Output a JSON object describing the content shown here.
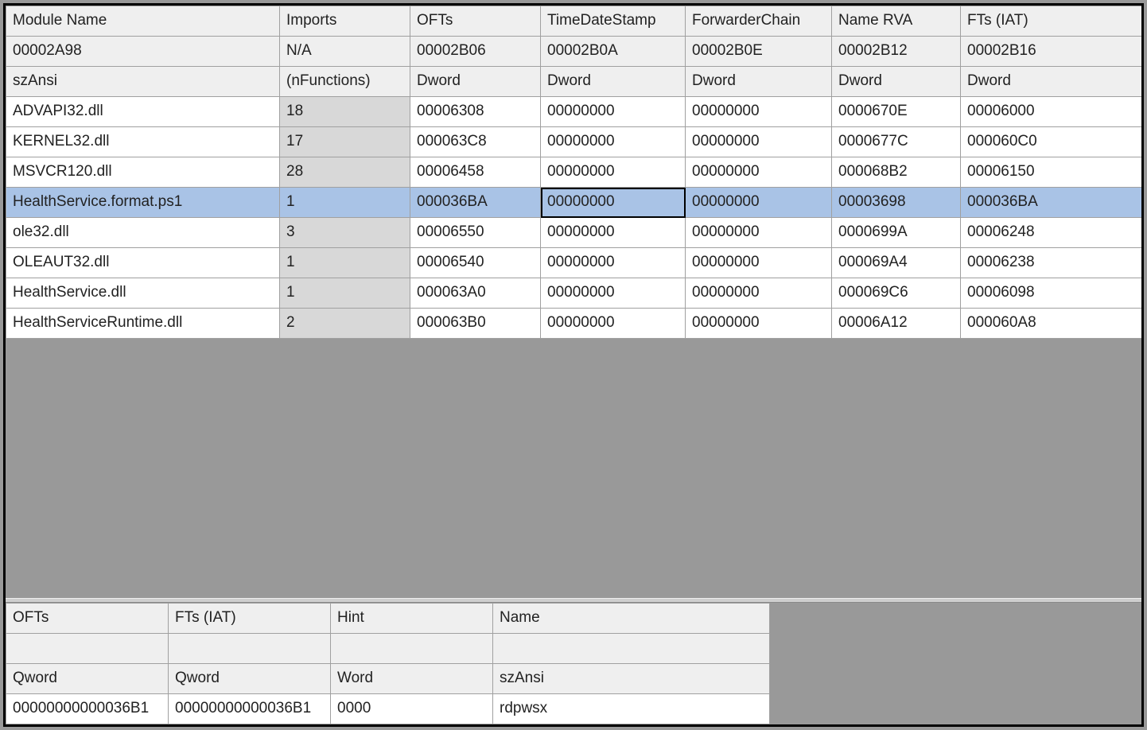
{
  "topTable": {
    "headerRow1": [
      "Module Name",
      "Imports",
      "OFTs",
      "TimeDateStamp",
      "ForwarderChain",
      "Name RVA",
      "FTs (IAT)"
    ],
    "headerRow2": [
      "00002A98",
      "N/A",
      "00002B06",
      "00002B0A",
      "00002B0E",
      "00002B12",
      "00002B16"
    ],
    "headerRow3": [
      "szAnsi",
      "(nFunctions)",
      "Dword",
      "Dword",
      "Dword",
      "Dword",
      "Dword"
    ],
    "rows": [
      {
        "module": "ADVAPI32.dll",
        "imports": "18",
        "ofts": "00006308",
        "tds": "00000000",
        "fc": "00000000",
        "rva": "0000670E",
        "fts": "00006000"
      },
      {
        "module": "KERNEL32.dll",
        "imports": "17",
        "ofts": "000063C8",
        "tds": "00000000",
        "fc": "00000000",
        "rva": "0000677C",
        "fts": "000060C0"
      },
      {
        "module": "MSVCR120.dll",
        "imports": "28",
        "ofts": "00006458",
        "tds": "00000000",
        "fc": "00000000",
        "rva": "000068B2",
        "fts": "00006150"
      },
      {
        "module": "HealthService.format.ps1",
        "imports": "1",
        "ofts": "000036BA",
        "tds": "00000000",
        "fc": "00000000",
        "rva": "00003698",
        "fts": "000036BA",
        "selected": true,
        "focusCol": 3
      },
      {
        "module": "ole32.dll",
        "imports": "3",
        "ofts": "00006550",
        "tds": "00000000",
        "fc": "00000000",
        "rva": "0000699A",
        "fts": "00006248"
      },
      {
        "module": "OLEAUT32.dll",
        "imports": "1",
        "ofts": "00006540",
        "tds": "00000000",
        "fc": "00000000",
        "rva": "000069A4",
        "fts": "00006238"
      },
      {
        "module": "HealthService.dll",
        "imports": "1",
        "ofts": "000063A0",
        "tds": "00000000",
        "fc": "00000000",
        "rva": "000069C6",
        "fts": "00006098"
      },
      {
        "module": "HealthServiceRuntime.dll",
        "imports": "2",
        "ofts": "000063B0",
        "tds": "00000000",
        "fc": "00000000",
        "rva": "00006A12",
        "fts": "000060A8"
      }
    ]
  },
  "bottomTable": {
    "headerRow1": [
      "OFTs",
      "FTs (IAT)",
      "Hint",
      "Name"
    ],
    "headerRow2": [
      "",
      "",
      "",
      ""
    ],
    "headerRow3": [
      "Qword",
      "Qword",
      "Word",
      "szAnsi"
    ],
    "rows": [
      {
        "ofts": "00000000000036B1",
        "fts": "00000000000036B1",
        "hint": "0000",
        "name": "rdpwsx"
      }
    ]
  }
}
